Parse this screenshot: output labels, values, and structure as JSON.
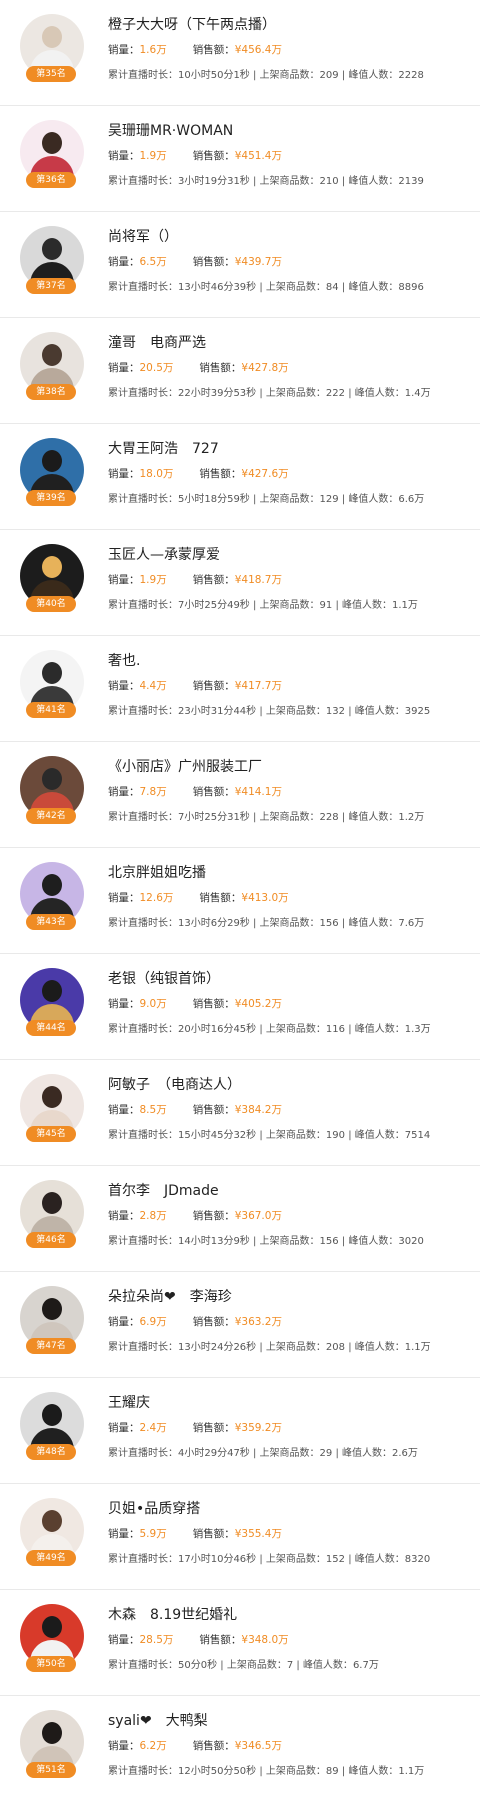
{
  "labels": {
    "sales": "销量：",
    "revenue": "销售额：",
    "duration": "累计直播时长：",
    "products": "上架商品数：",
    "peak": "峰值人数：",
    "sep": " | "
  },
  "colors": {
    "accent": "#f08c24",
    "text": "#222222",
    "muted": "#555555",
    "divider": "#e9e9e9"
  },
  "rows": [
    {
      "rank": "第35名",
      "name": "橙子大大呀（下午两点播）",
      "sales": "1.6万",
      "revenue": "¥456.4万",
      "duration": "10小时50分1秒",
      "products": "209",
      "peak": "2228",
      "avatar": {
        "bg": "#ece7e2",
        "hair": "#d8c8b6",
        "shirt": "#f2f2f2"
      }
    },
    {
      "rank": "第36名",
      "name": "吴珊珊MR·WOMAN",
      "sales": "1.9万",
      "revenue": "¥451.4万",
      "duration": "3小时19分31秒",
      "products": "210",
      "peak": "2139",
      "avatar": {
        "bg": "#f7eaf0",
        "hair": "#3a2a22",
        "shirt": "#c73a48"
      }
    },
    {
      "rank": "第37名",
      "name": "尚将军（）",
      "sales": "6.5万",
      "revenue": "¥439.7万",
      "duration": "13小时46分39秒",
      "products": "84",
      "peak": "8896",
      "avatar": {
        "bg": "#d9d9d9",
        "hair": "#2b2b2b",
        "shirt": "#1e1e1e"
      }
    },
    {
      "rank": "第38名",
      "name": "潼哥　电商严选",
      "sales": "20.5万",
      "revenue": "¥427.8万",
      "duration": "22小时39分53秒",
      "products": "222",
      "peak": "1.4万",
      "avatar": {
        "bg": "#e8e3de",
        "hair": "#4a3a30",
        "shirt": "#b8a99b"
      }
    },
    {
      "rank": "第39名",
      "name": "大胃王阿浩　727",
      "sales": "18.0万",
      "revenue": "¥427.6万",
      "duration": "5小时18分59秒",
      "products": "129",
      "peak": "6.6万",
      "avatar": {
        "bg": "#2f6fa8",
        "hair": "#1b1b1b",
        "shirt": "#202020"
      }
    },
    {
      "rank": "第40名",
      "name": "玉匠人—承蒙厚爱",
      "sales": "1.9万",
      "revenue": "¥418.7万",
      "duration": "7小时25分49秒",
      "products": "91",
      "peak": "1.1万",
      "avatar": {
        "bg": "#1c1c1c",
        "hair": "#e7b25a",
        "shirt": "#3a2a1a"
      }
    },
    {
      "rank": "第41名",
      "name": "奢也.",
      "sales": "4.4万",
      "revenue": "¥417.7万",
      "duration": "23小时31分44秒",
      "products": "132",
      "peak": "3925",
      "avatar": {
        "bg": "#f4f4f4",
        "hair": "#2b2b2b",
        "shirt": "#3a3a3a"
      }
    },
    {
      "rank": "第42名",
      "name": "《小丽店》广州服装工厂",
      "sales": "7.8万",
      "revenue": "¥414.1万",
      "duration": "7小时25分31秒",
      "products": "228",
      "peak": "1.2万",
      "avatar": {
        "bg": "#6b4a3a",
        "hair": "#2a2a2a",
        "shirt": "#c94a3a"
      }
    },
    {
      "rank": "第43名",
      "name": "北京胖姐姐吃播",
      "sales": "12.6万",
      "revenue": "¥413.0万",
      "duration": "13小时6分29秒",
      "products": "156",
      "peak": "7.6万",
      "avatar": {
        "bg": "#c7b6e6",
        "hair": "#1e1e1e",
        "shirt": "#252525"
      }
    },
    {
      "rank": "第44名",
      "name": "老银（纯银首饰）",
      "sales": "9.0万",
      "revenue": "¥405.2万",
      "duration": "20小时16分45秒",
      "products": "116",
      "peak": "1.3万",
      "avatar": {
        "bg": "#4a3aa8",
        "hair": "#1b1b1b",
        "shirt": "#d8a85a"
      }
    },
    {
      "rank": "第45名",
      "name": "阿敏子　（电商达人）",
      "sales": "8.5万",
      "revenue": "¥384.2万",
      "duration": "15小时45分32秒",
      "products": "190",
      "peak": "7514",
      "avatar": {
        "bg": "#efe6e2",
        "hair": "#3a2a22",
        "shirt": "#e8d8cc"
      }
    },
    {
      "rank": "第46名",
      "name": "首尔李　JDmade",
      "sales": "2.8万",
      "revenue": "¥367.0万",
      "duration": "14小时13分9秒",
      "products": "156",
      "peak": "3020",
      "avatar": {
        "bg": "#e6e0d8",
        "hair": "#2a2220",
        "shirt": "#bfb4a8"
      }
    },
    {
      "rank": "第47名",
      "name": "朵拉朵尚❤　李海珍",
      "sales": "6.9万",
      "revenue": "¥363.2万",
      "duration": "13小时24分26秒",
      "products": "208",
      "peak": "1.1万",
      "avatar": {
        "bg": "#d8d4cf",
        "hair": "#1e1a18",
        "shirt": "#cfc6bd"
      }
    },
    {
      "rank": "第48名",
      "name": "王耀庆",
      "sales": "2.4万",
      "revenue": "¥359.2万",
      "duration": "4小时29分47秒",
      "products": "29",
      "peak": "2.6万",
      "avatar": {
        "bg": "#dcdcdc",
        "hair": "#1b1b1b",
        "shirt": "#202020"
      }
    },
    {
      "rank": "第49名",
      "name": "贝姐•品质穿搭",
      "sales": "5.9万",
      "revenue": "¥355.4万",
      "duration": "17小时10分46秒",
      "products": "152",
      "peak": "8320",
      "avatar": {
        "bg": "#f0e8e2",
        "hair": "#5a4030",
        "shirt": "#f4f0ec"
      }
    },
    {
      "rank": "第50名",
      "name": "木森　8.19世纪婚礼",
      "sales": "28.5万",
      "revenue": "¥348.0万",
      "duration": "50分0秒",
      "products": "7",
      "peak": "6.7万",
      "avatar": {
        "bg": "#d83a2a",
        "hair": "#1b1b1b",
        "shirt": "#f2f2f2"
      }
    },
    {
      "rank": "第51名",
      "name": "syali❤　大鸭梨",
      "sales": "6.2万",
      "revenue": "¥346.5万",
      "duration": "12小时50分50秒",
      "products": "89",
      "peak": "1.1万",
      "avatar": {
        "bg": "#e4ddd6",
        "hair": "#1e1a18",
        "shirt": "#d0c4b8"
      }
    }
  ]
}
